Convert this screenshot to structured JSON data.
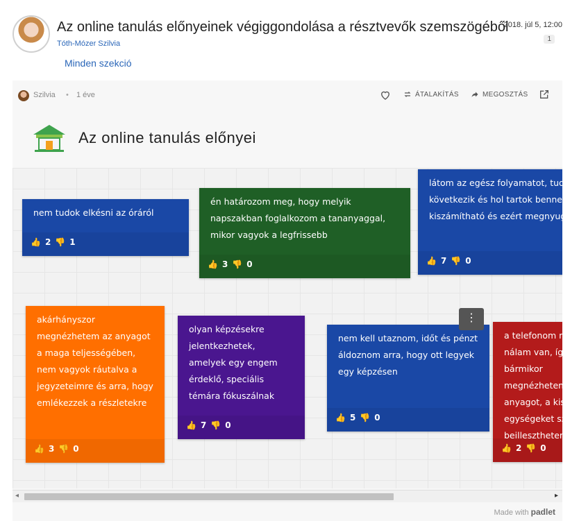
{
  "post": {
    "title": "Az online tanulás előnyeinek végiggondolása a résztvevők szemszögéből",
    "author": "Tóth-Mózer Szilvia",
    "date": "2018. júl 5, 12:00",
    "reply_count": "1",
    "section_link": "Minden szekció"
  },
  "embed": {
    "user": "Szilvia",
    "dot": "•",
    "age": "1 éve",
    "actions": {
      "remake": "ÁTALAKÍTÁS",
      "share": "MEGOSZTÁS"
    },
    "board_title": "Az online tanulás előnyei",
    "made_with": "Made with",
    "brand": "padlet"
  },
  "cards": [
    {
      "text": "nem tudok elkésni az óráról",
      "likes": "2",
      "dislikes": "1",
      "color": "#1a48a6"
    },
    {
      "text": "én határozom meg, hogy melyik napszakban foglalkozom a tananyaggal, mikor vagyok a legfrissebb",
      "likes": "3",
      "dislikes": "0",
      "color": "#1f5f26"
    },
    {
      "text": "látom az egész folyamatot, tudom, mi következik és hol tartok benne, így kiszámítható és ezért megnyugtató",
      "likes": "7",
      "dislikes": "0",
      "color": "#1a48a6"
    },
    {
      "text": "akárhányszor megnézhetem az anyagot a maga teljességében, nem vagyok ráutalva a jegyzeteimre és arra, hogy emlékezzek a részletekre",
      "likes": "3",
      "dislikes": "0",
      "color": "#ff6f00"
    },
    {
      "text": "olyan képzésekre jelentkezhetek, amelyek egy engem érdeklő, speciális témára fókuszálnak",
      "likes": "7",
      "dislikes": "0",
      "color": "#4a168f"
    },
    {
      "text": "nem kell utaznom, időt és pénzt áldoznom arra, hogy ott legyek egy képzésen",
      "likes": "5",
      "dislikes": "0",
      "color": "#1a48a6"
    },
    {
      "text": "a telefonom mindig nálam van, így bármikor megnézhetem az anyagot, a kisebb egységeket szabadon beilleszthetem",
      "likes": "2",
      "dislikes": "0",
      "color": "#b31b1b"
    }
  ]
}
